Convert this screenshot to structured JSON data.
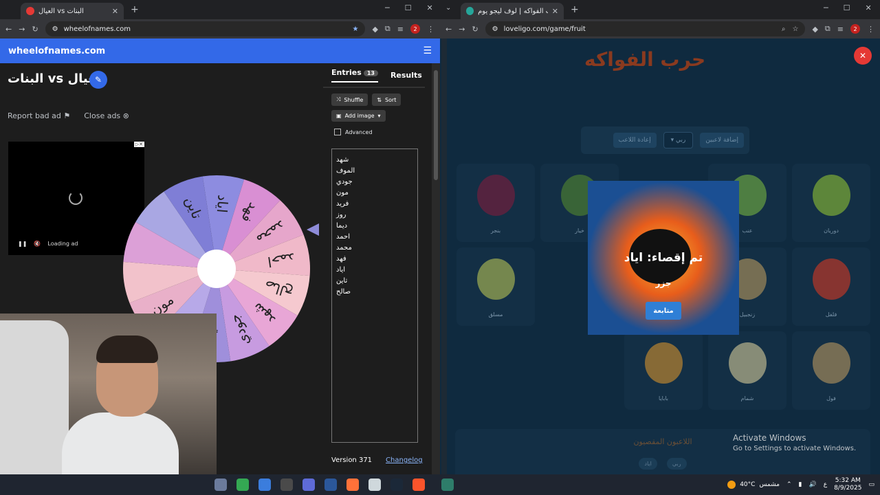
{
  "left_window": {
    "tab_title": "العيال vs البنات",
    "url": "wheelofnames.com",
    "site_name": "wheelofnames.com",
    "wheel_title": "البنات vs العيال",
    "report_ad": "Report bad ad",
    "close_ads": "Close ads",
    "ad_loading": "Loading ad",
    "tabs": {
      "entries": "Entries",
      "entries_count": "13",
      "results": "Results"
    },
    "buttons": {
      "shuffle": "Shuffle",
      "sort": "Sort",
      "add_image": "Add image",
      "advanced": "Advanced"
    },
    "entries": [
      "شهد",
      "الموف",
      "جودي",
      "مون",
      "فريد",
      "روز",
      "ديما",
      "احمد",
      "محمد",
      "فهد",
      "اياد",
      "تاين",
      "صالح"
    ],
    "wheel_labels": [
      "تاين",
      "اياد",
      "فهد",
      "محمد",
      "احمد",
      "صالح",
      "شهد",
      "جودي",
      "ديما",
      "روز",
      "مون"
    ],
    "version": "Version 371",
    "changelog": "Changelog"
  },
  "right_window": {
    "tab_title": "لعبة حرب الفواكه | لوف ليجو يوم",
    "url": "loveligo.com/game/fruit",
    "game_title": "حرب الفواكه",
    "controls": {
      "add_player": "إضافة لاعبين",
      "select": "ربي",
      "reset": "إعادة اللاعب"
    },
    "cards": [
      {
        "label": "دوريان",
        "color": "#9acd32"
      },
      {
        "label": "عنب",
        "color": "#7fbf3f"
      },
      {
        "label": "خيار",
        "color": "#5a8f2c"
      },
      {
        "label": "بنجر",
        "color": "#8b1a3a"
      },
      {
        "label": "فلفل",
        "color": "#e8391f"
      },
      {
        "label": "زنجبيل",
        "color": "#c8a25e"
      },
      {
        "label": "مسلق",
        "color": "#c6cf56"
      },
      {
        "label": "فول",
        "color": "#c8a060"
      },
      {
        "label": "شمام",
        "color": "#e8d9a0"
      },
      {
        "label": "بابايا",
        "color": "#e89a2a"
      }
    ],
    "modal": {
      "message": "تم إقصاء: اياد",
      "fruit": "جزر",
      "button": "متابعة"
    },
    "excluded_title": "اللاعبون المقصيون",
    "excluded_players": [
      "اياد",
      "ربي"
    ]
  },
  "windows_notice": {
    "title": "Activate Windows",
    "subtitle": "Go to Settings to activate Windows."
  },
  "taskbar": {
    "temperature": "40°C",
    "weather": "مشمس",
    "lang": "ع",
    "time": "5:32 AM",
    "date": "8/9/2025"
  }
}
